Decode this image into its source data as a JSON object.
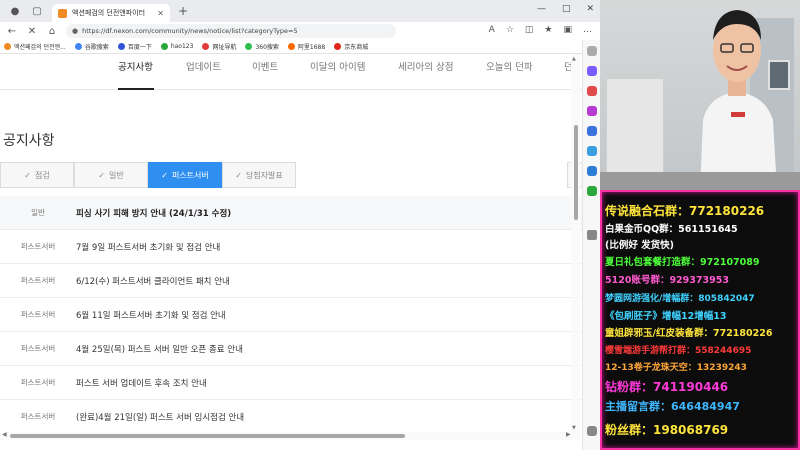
{
  "browser": {
    "tab_title": "액션페검의 던전앤파이터",
    "url": "https://df.nexon.com/community/news/notice/list?categoryType=5",
    "bookmarks": [
      {
        "label": "액션페검의 던전앤...",
        "color": "#f08a24"
      },
      {
        "label": "谷歌搜索",
        "color": "#4285f4"
      },
      {
        "label": "百度一下",
        "color": "#2e55d6"
      },
      {
        "label": "hao123",
        "color": "#2aa83a"
      },
      {
        "label": "网址导航",
        "color": "#e33b3b"
      },
      {
        "label": "360搜索",
        "color": "#2fbf50"
      },
      {
        "label": "阿里1688",
        "color": "#ff6a00"
      },
      {
        "label": "京东商城",
        "color": "#e1251b"
      }
    ]
  },
  "nav": {
    "items": [
      "공지사항",
      "업데이트",
      "이벤트",
      "이달의 아이템",
      "세리아의 상점",
      "오늘의 던파",
      "던"
    ],
    "active": "공지사항"
  },
  "page": {
    "title": "공지사항",
    "filters": [
      {
        "label": "점검",
        "active": false
      },
      {
        "label": "일반",
        "active": false
      },
      {
        "label": "퍼스트서버",
        "active": true
      },
      {
        "label": "당첨자발표",
        "active": false
      }
    ],
    "notices": [
      {
        "category": "일반",
        "title": "피싱 사기 피해 방지 안내 (24/1/31 수정)",
        "pinned": true
      },
      {
        "category": "퍼스트서버",
        "title": "7월 9일 퍼스트서버 초기화 및 점검 안내"
      },
      {
        "category": "퍼스트서버",
        "title": "6/12(수) 퍼스트서버 클라이언트 패치 안내"
      },
      {
        "category": "퍼스트서버",
        "title": "6월 11일 퍼스트서버 초기화 및 점검 안내"
      },
      {
        "category": "퍼스트서버",
        "title": "4월 25일(목) 퍼스트 서버 일반 오픈 종료 안내"
      },
      {
        "category": "퍼스트서버",
        "title": "퍼스트 서버 업데이트 후속 조치 안내"
      },
      {
        "category": "퍼스트서버",
        "title": "(완료)4월 21일(일) 퍼스트 서버 임시점검 안내"
      }
    ]
  },
  "overlay": {
    "lines": [
      {
        "text": "传说融合石群：772180226",
        "color": "#ffe53b"
      },
      {
        "text": "白果金币QQ群：561151645",
        "color": "#ffffff"
      },
      {
        "text": "(比例好 发货快)",
        "color": "#ffffff"
      },
      {
        "text": "夏日礼包套餐打造群：972107089",
        "color": "#4cff3a"
      },
      {
        "text": "5120账号群：929373953",
        "color": "#ff5ad0"
      },
      {
        "text": "梦圆网游强化/增幅群：805842047",
        "color": "#3fd2ff"
      },
      {
        "text": "《包刷胚子》增幅12增幅13",
        "color": "#3fd2ff"
      },
      {
        "text": "童姐辟邪玉/红皮装备群：772180226",
        "color": "#ffe53b"
      },
      {
        "text": "樱雪端游手游帮打群：558244695",
        "color": "#ff3a3a"
      },
      {
        "text": "12-13卷子龙珠天空：13239243",
        "color": "#ffa63a"
      },
      {
        "text": "钻粉群：741190446",
        "color": "#ff3ad8"
      },
      {
        "text": "主播留言群：646484947",
        "color": "#3fb7ff"
      },
      {
        "text": "粉丝群：198068769",
        "color": "#ffe53b"
      }
    ]
  }
}
